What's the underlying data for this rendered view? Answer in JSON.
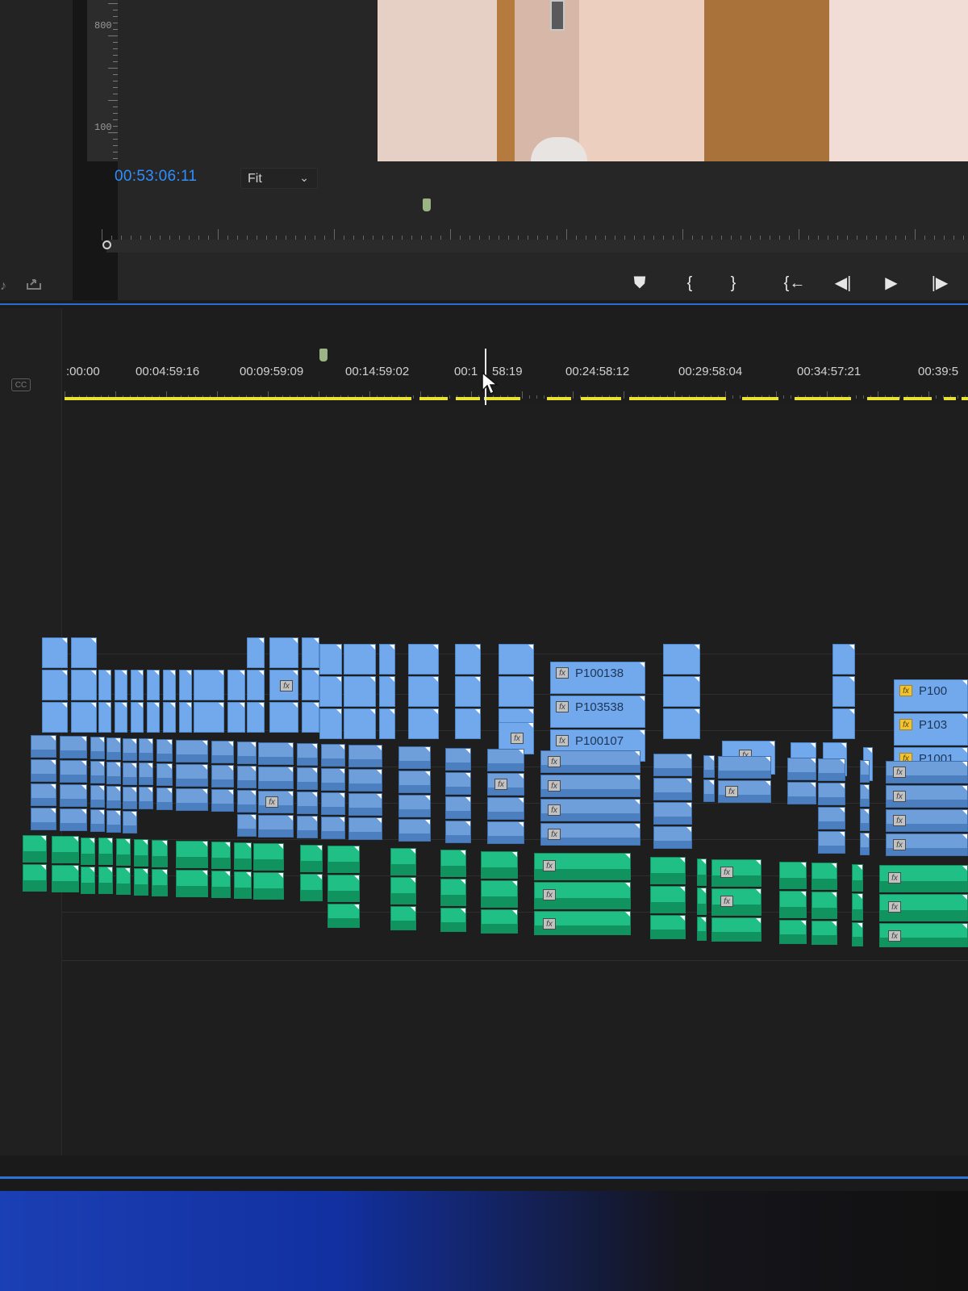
{
  "program_monitor": {
    "timecode": "00:53:06:11",
    "zoom": "Fit",
    "scale_labels": [
      "800",
      "100"
    ],
    "controls": [
      {
        "name": "add-marker-button",
        "glyph": "⛊"
      },
      {
        "name": "mark-in-button",
        "glyph": "{"
      },
      {
        "name": "mark-out-button",
        "glyph": "}"
      },
      {
        "name": "go-to-in-button",
        "glyph": "{←"
      },
      {
        "name": "step-back-button",
        "glyph": "◀|"
      },
      {
        "name": "play-button",
        "glyph": "▶"
      },
      {
        "name": "step-forward-button",
        "glyph": "|▶"
      }
    ]
  },
  "timeline": {
    "cc_label": "CC",
    "ruler_timecodes": [
      ":00:00",
      "00:04:59:16",
      "00:09:59:09",
      "00:14:59:02",
      "00:1",
      "58:19",
      "00:24:58:12",
      "00:29:58:04",
      "00:34:57:21",
      "00:39:5"
    ],
    "clip_names": [
      "P100138",
      "P103538",
      "P100107",
      "P100",
      "P103",
      "P1001"
    ],
    "colors": {
      "video_clip": "#72a9ec",
      "audio_clip_blue": "#6e9fda",
      "audio_clip_green": "#1fbf86",
      "render_bar": "#e9e233",
      "timecode_blue": "#2f8fff"
    }
  }
}
